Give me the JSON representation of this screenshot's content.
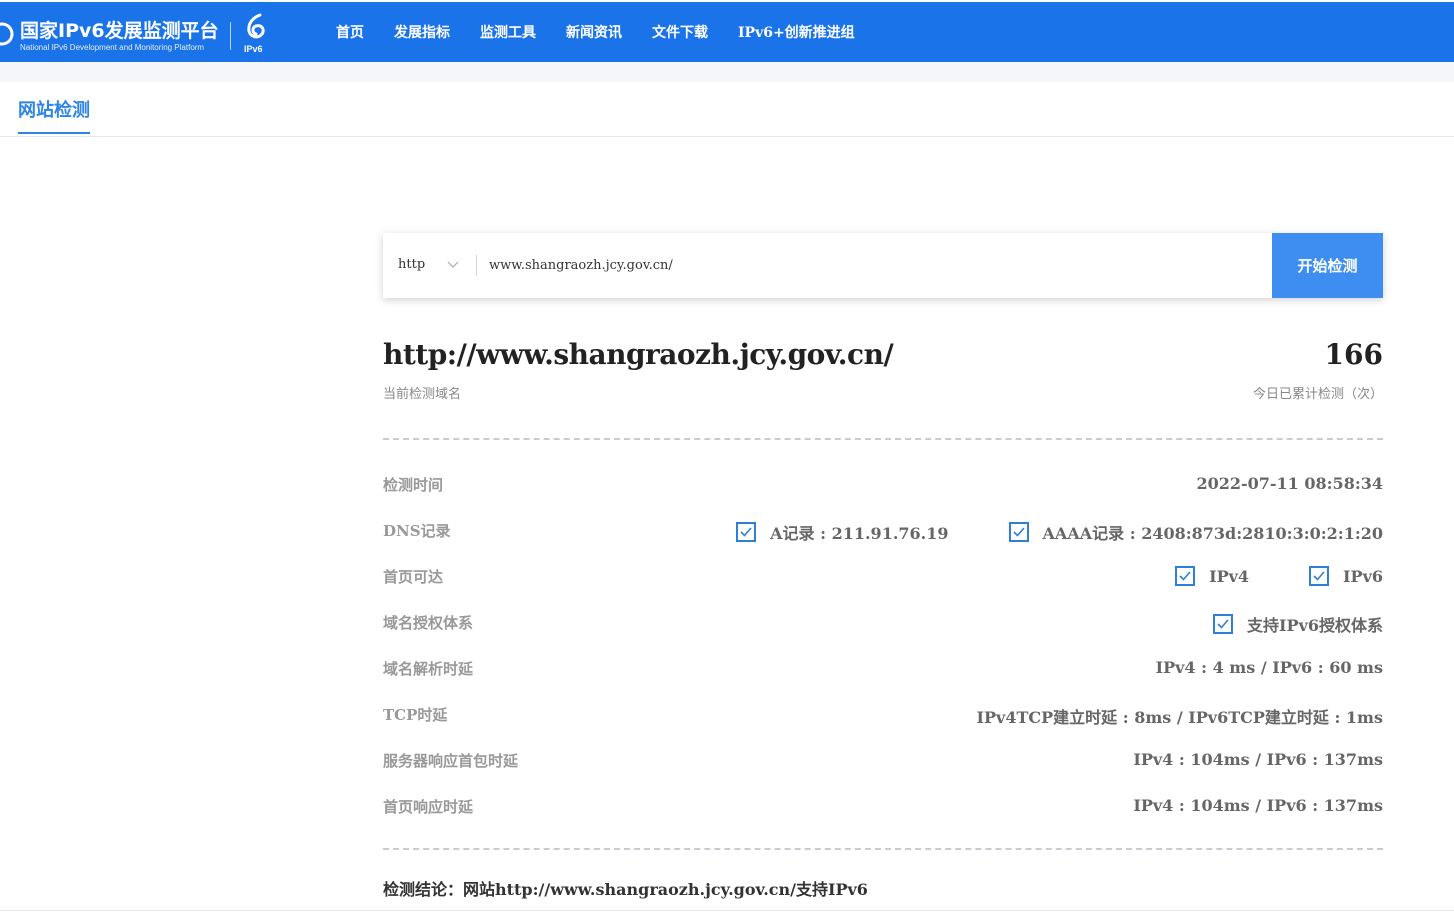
{
  "header": {
    "logo_title": "国家IPv6发展监测平台",
    "logo_subtitle": "National IPv6 Development and Monitoring Platform",
    "ipv6_badge": "IPv6",
    "nav": [
      "首页",
      "发展指标",
      "监测工具",
      "新闻资讯",
      "文件下载",
      "IPv6+创新推进组"
    ],
    "brand_color": "#1a73e8"
  },
  "tab": {
    "label": "网站检测",
    "accent_color": "#2f85e6"
  },
  "search": {
    "protocol": "http",
    "url_value": "www.shangraozh.jcy.gov.cn/",
    "button_label": "开始检测"
  },
  "result": {
    "domain": "http://www.shangraozh.jcy.gov.cn/",
    "domain_caption": "当前检测域名",
    "count": "166",
    "count_caption": "今日已累计检测（次）",
    "rows": {
      "check_time": {
        "label": "检测时间",
        "value": "2022-07-11 08:58:34"
      },
      "dns": {
        "label": "DNS记录",
        "a_record": "A记录 : 211.91.76.19",
        "aaaa_record": "AAAA记录 : 2408:873d:2810:3:0:2:1:20"
      },
      "homepage_reach": {
        "label": "首页可达",
        "ipv4": "IPv4",
        "ipv6": "IPv6"
      },
      "auth": {
        "label": "域名授权体系",
        "value": "支持IPv6授权体系"
      },
      "resolve_delay": {
        "label": "域名解析时延",
        "value": "IPv4 : 4 ms / IPv6 : 60 ms"
      },
      "tcp_delay": {
        "label": "TCP时延",
        "value": "IPv4TCP建立时延 : 8ms / IPv6TCP建立时延 : 1ms"
      },
      "server_first_packet": {
        "label": "服务器响应首包时延",
        "value": "IPv4 : 104ms / IPv6 : 137ms"
      },
      "homepage_response": {
        "label": "首页响应时延",
        "value": "IPv4 : 104ms / IPv6 : 137ms"
      }
    },
    "conclusion_label": "检测结论：",
    "conclusion_text": "网站http://www.shangraozh.jcy.gov.cn/支持IPv6",
    "check_color": "#2f7fd6"
  }
}
